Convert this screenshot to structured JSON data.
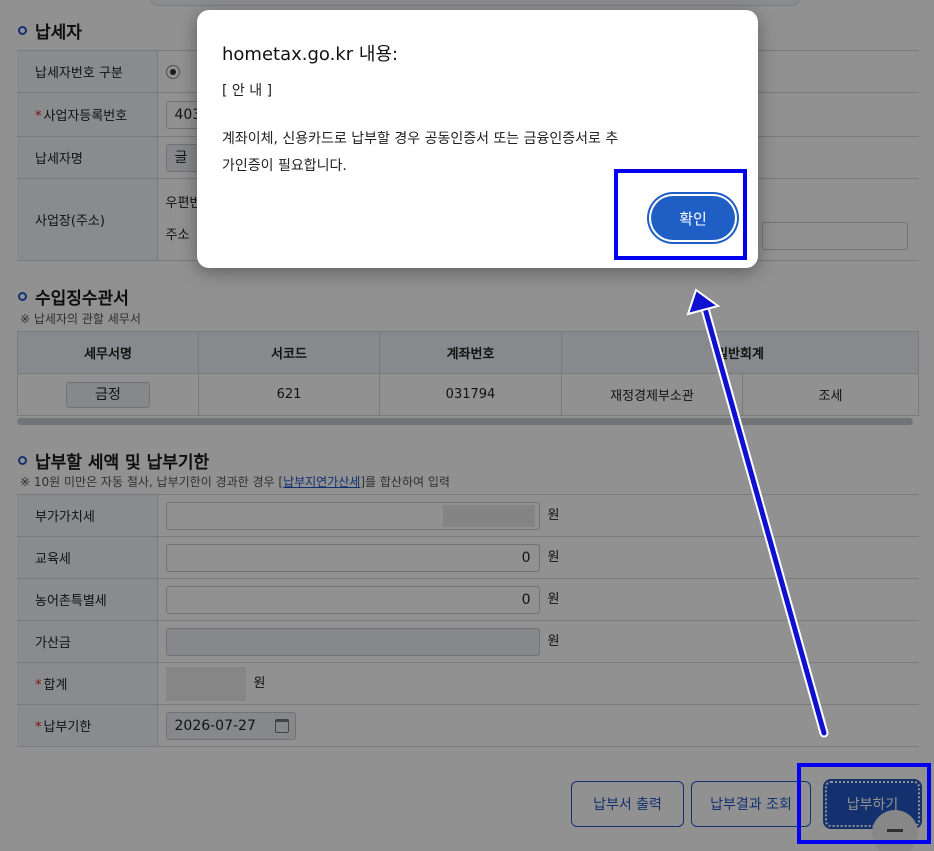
{
  "taxpayer": {
    "title": "납세자",
    "rows": {
      "type_label": "납세자번호 구분",
      "bizno_label": "사업자등록번호",
      "bizno_value": "403",
      "name_label": "납세자명",
      "name_value": "글 ",
      "addr_label": "사업장(주소)",
      "zip_label": "우편번",
      "addr_sub_label": "주소"
    }
  },
  "office": {
    "title": "수입징수관서",
    "note": "※ 납세자의 관할 세무서",
    "headers": [
      "세무서명",
      "서코드",
      "계좌번호",
      "일반회계"
    ],
    "row": [
      "금정",
      "621",
      "031794",
      "재정경제부소관",
      "조세"
    ]
  },
  "amounts": {
    "title": "납부할 세액 및 납부기한",
    "note_prefix": "※ 10원 미만은 자동 절사, 납부기한이 경과한 경우 [",
    "note_link": "납부지연가산세",
    "note_suffix": "]를 합산하여 입력",
    "rows": {
      "vat_label": "부가가치세",
      "edu_label": "교육세",
      "edu_value": "0",
      "rural_label": "농어촌특별세",
      "rural_value": "0",
      "add_label": "가산금",
      "total_label": "합계",
      "due_label": "납부기한",
      "due_value": "2026-07-27"
    },
    "unit": "원"
  },
  "buttons": {
    "print": "납부서 출력",
    "result": "납부결과 조회",
    "pay": "납부하기"
  },
  "dialog": {
    "title": "hometax.go.kr 내용:",
    "line1": "[ 안 내 ]",
    "message_line1": "계좌이체, 신용카드로 납부할 경우 공동인증서 또는 금융인증서로 추",
    "message_line2": "가인증이 필요합니다.",
    "ok": "확인"
  },
  "colors": {
    "accent": "#2456c4",
    "highlight": "#0000ee",
    "dialog_button": "#1f5fc5"
  },
  "icons": {
    "calendar": "calendar-icon",
    "radio": "radio-icon",
    "arrow": "annotation-arrow-icon"
  }
}
